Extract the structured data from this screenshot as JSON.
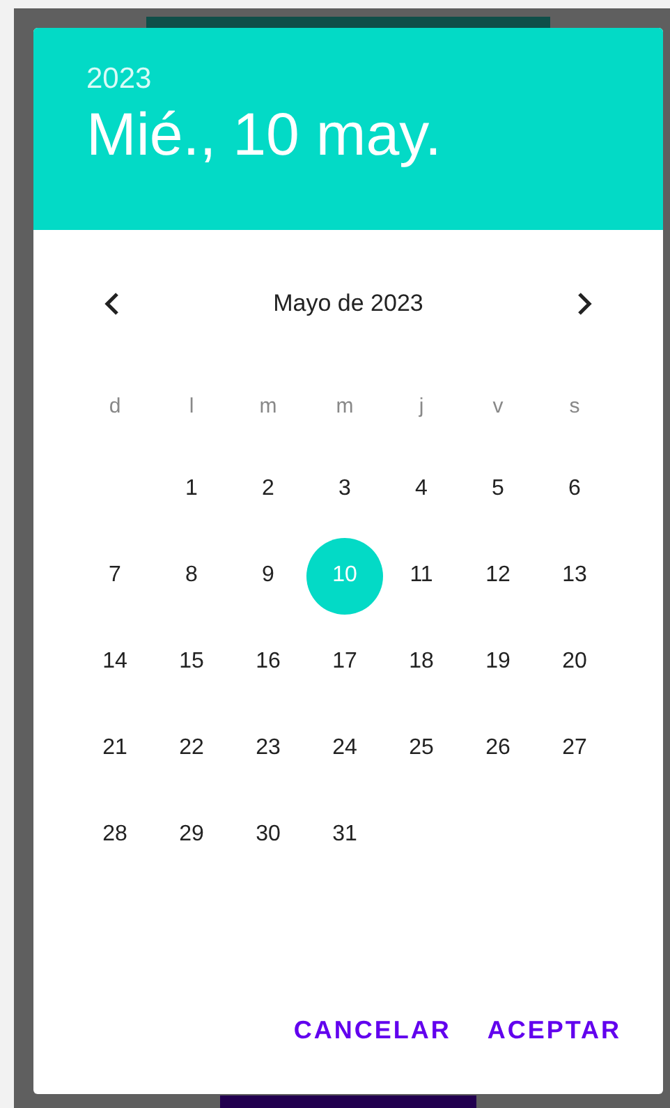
{
  "header": {
    "year": "2023",
    "date": "Mié., 10 may."
  },
  "month_nav": {
    "label": "Mayo de 2023"
  },
  "weekdays": [
    "d",
    "l",
    "m",
    "m",
    "j",
    "v",
    "s"
  ],
  "weeks": [
    [
      {
        "day": "1",
        "selected": false
      },
      {
        "day": "2",
        "selected": false
      },
      {
        "day": "3",
        "selected": false
      },
      {
        "day": "4",
        "selected": false
      },
      {
        "day": "5",
        "selected": false
      },
      {
        "day": "6",
        "selected": false
      }
    ],
    [
      {
        "day": "7",
        "selected": false
      },
      {
        "day": "8",
        "selected": false
      },
      {
        "day": "9",
        "selected": false
      },
      {
        "day": "10",
        "selected": true
      },
      {
        "day": "11",
        "selected": false
      },
      {
        "day": "12",
        "selected": false
      },
      {
        "day": "13",
        "selected": false
      }
    ],
    [
      {
        "day": "14",
        "selected": false
      },
      {
        "day": "15",
        "selected": false
      },
      {
        "day": "16",
        "selected": false
      },
      {
        "day": "17",
        "selected": false
      },
      {
        "day": "18",
        "selected": false
      },
      {
        "day": "19",
        "selected": false
      },
      {
        "day": "20",
        "selected": false
      }
    ],
    [
      {
        "day": "21",
        "selected": false
      },
      {
        "day": "22",
        "selected": false
      },
      {
        "day": "23",
        "selected": false
      },
      {
        "day": "24",
        "selected": false
      },
      {
        "day": "25",
        "selected": false
      },
      {
        "day": "26",
        "selected": false
      },
      {
        "day": "27",
        "selected": false
      }
    ],
    [
      {
        "day": "28",
        "selected": false
      },
      {
        "day": "29",
        "selected": false
      },
      {
        "day": "30",
        "selected": false
      },
      {
        "day": "31",
        "selected": false
      }
    ]
  ],
  "buttons": [
    "CANCELAR",
    "ACEPTAR"
  ]
}
